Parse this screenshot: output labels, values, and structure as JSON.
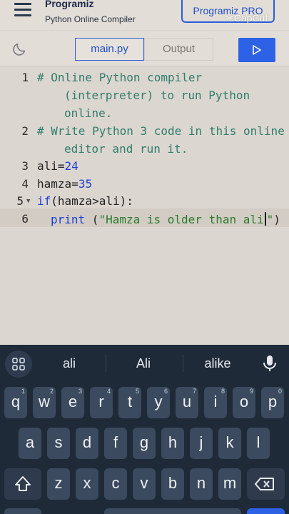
{
  "header": {
    "brand": "Programiz",
    "subtitle": "Python Online Compiler",
    "pro_button": "Programiz PRO",
    "watermark": "CapCut"
  },
  "toolbar": {
    "theme_icon": "moon-icon",
    "tabs": [
      {
        "label": "main.py",
        "active": true
      },
      {
        "label": "Output",
        "active": false
      }
    ],
    "run_icon": "play-icon",
    "accent": "#2e62e6"
  },
  "editor": {
    "line_numbers": [
      "1",
      "2",
      "3",
      "4",
      "5",
      "6"
    ],
    "lines": {
      "l1a": "# Online Python compiler",
      "l1b": "(interpreter) to run Python",
      "l1c": "online.",
      "l2a": "# Write Python 3 code in this online",
      "l2b": "editor and run it.",
      "l3_var": "ali",
      "l3_op": "=",
      "l3_val": "24",
      "l4_var": "hamza",
      "l4_op": "=",
      "l4_val": "35",
      "l5_kw": "if",
      "l5_rest": "(hamza>ali):",
      "l6_kw": "print",
      "l6_open": " (",
      "l6_str_a": "\"Hamza is older than ali",
      "l6_str_b": "\"",
      "l6_close": ")"
    },
    "colors": {
      "comment": "#2f7d6b",
      "number": "#1d3fd1",
      "keyword": "#1d3fd1",
      "string": "#2a7a2a"
    }
  },
  "keyboard": {
    "suggestions": [
      "ali",
      "Ali",
      "alike"
    ],
    "row1": [
      {
        "key": "q",
        "hint": "1"
      },
      {
        "key": "w",
        "hint": "2"
      },
      {
        "key": "e",
        "hint": "3"
      },
      {
        "key": "r",
        "hint": "4"
      },
      {
        "key": "t",
        "hint": "5"
      },
      {
        "key": "y",
        "hint": "6"
      },
      {
        "key": "u",
        "hint": "7"
      },
      {
        "key": "i",
        "hint": "8"
      },
      {
        "key": "o",
        "hint": "9"
      },
      {
        "key": "p",
        "hint": "0"
      }
    ],
    "row2": [
      "a",
      "s",
      "d",
      "f",
      "g",
      "h",
      "j",
      "k",
      "l"
    ],
    "row3": [
      "z",
      "x",
      "c",
      "v",
      "b",
      "n",
      "m"
    ],
    "shift_icon": "shift-icon",
    "backspace_icon": "backspace-icon",
    "mic_icon": "microphone-icon",
    "apps_icon": "grid-icon"
  }
}
